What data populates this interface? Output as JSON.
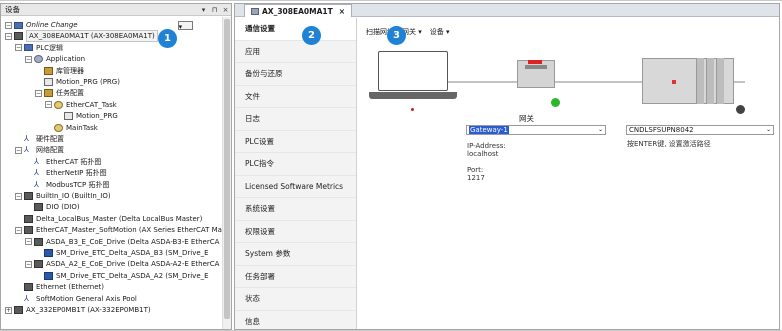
{
  "devices_panel": {
    "title": "设备",
    "header_buttons": [
      "▾",
      "⊓",
      "×"
    ],
    "tree": [
      {
        "label": "Online Change",
        "level": 0,
        "expander": "−",
        "icon": "online-change-icon",
        "italic": true,
        "has_dropdown": true
      },
      {
        "label": "AX_308EA0MA1T (AX-308EA0MA1T)",
        "level": 0,
        "expander": "−",
        "icon": "device-icon",
        "boxed": true
      },
      {
        "label": "PLC逻辑",
        "level": 1,
        "expander": "−",
        "icon": "plc-logic-icon"
      },
      {
        "label": "Application",
        "level": 2,
        "expander": "−",
        "icon": "application-icon"
      },
      {
        "label": "库管理器",
        "level": 3,
        "expander": "",
        "icon": "library-manager-icon"
      },
      {
        "label": "Motion_PRG (PRG)",
        "level": 3,
        "expander": "",
        "icon": "program-icon"
      },
      {
        "label": "任务配置",
        "level": 3,
        "expander": "−",
        "icon": "task-config-icon"
      },
      {
        "label": "EtherCAT_Task",
        "level": 4,
        "expander": "−",
        "icon": "task-icon"
      },
      {
        "label": "Motion_PRG",
        "level": 5,
        "expander": "",
        "icon": "program-icon"
      },
      {
        "label": "MainTask",
        "level": 4,
        "expander": "",
        "icon": "task-icon"
      },
      {
        "label": "硬件配置",
        "level": 1,
        "expander": "",
        "icon": "hardware-config-icon"
      },
      {
        "label": "网络配置",
        "level": 1,
        "expander": "−",
        "icon": "network-config-icon"
      },
      {
        "label": "EtherCAT 拓扑图",
        "level": 2,
        "expander": "",
        "icon": "topology-icon"
      },
      {
        "label": "EtherNetIP 拓扑图",
        "level": 2,
        "expander": "",
        "icon": "topology-icon"
      },
      {
        "label": "ModbusTCP 拓扑图",
        "level": 2,
        "expander": "",
        "icon": "topology-icon"
      },
      {
        "label": "BuiltIn_IO (BuiltIn_IO)",
        "level": 1,
        "expander": "−",
        "icon": "device-icon"
      },
      {
        "label": "DIO (DIO)",
        "level": 2,
        "expander": "",
        "icon": "device-icon"
      },
      {
        "label": "Delta_LocalBus_Master (Delta LocalBus Master)",
        "level": 1,
        "expander": "",
        "icon": "device-icon"
      },
      {
        "label": "EtherCAT_Master_SoftMotion (AX Series EtherCAT Mas",
        "level": 1,
        "expander": "−",
        "icon": "device-icon"
      },
      {
        "label": "ASDA_B3_E_CoE_Drive (Delta ASDA-B3-E EtherCA",
        "level": 2,
        "expander": "−",
        "icon": "device-icon"
      },
      {
        "label": "SM_Drive_ETC_Delta_ASDA_B3 (SM_Drive_E",
        "level": 3,
        "expander": "",
        "icon": "drive-icon"
      },
      {
        "label": "ASDA_A2_E_CoE_Drive (Delta ASDA-A2-E EtherCA",
        "level": 2,
        "expander": "−",
        "icon": "device-icon"
      },
      {
        "label": "SM_Drive_ETC_Delta_ASDA_A2 (SM_Drive_E",
        "level": 3,
        "expander": "",
        "icon": "drive-icon"
      },
      {
        "label": "Ethernet (Ethernet)",
        "level": 1,
        "expander": "",
        "icon": "device-icon"
      },
      {
        "label": "SoftMotion General Axis Pool",
        "level": 1,
        "expander": "",
        "icon": "axis-pool-icon"
      },
      {
        "label": "AX_332EP0MB1T (AX-332EP0MB1T)",
        "level": 0,
        "expander": "+",
        "icon": "device-icon"
      }
    ]
  },
  "editor": {
    "tab_label": "AX_308EA0MA1T",
    "tab_close": "×",
    "nav_items": [
      "通信设置",
      "应用",
      "备份与还原",
      "文件",
      "日志",
      "PLC设置",
      "PLC指令",
      "Licensed Software Metrics",
      "系统设置",
      "权限设置",
      "System 参数",
      "任务部署",
      "状态",
      "信息"
    ],
    "selected_nav": "通信设置",
    "toolbar": [
      "扫描网络",
      "网关 ▾",
      "设备 ▾"
    ],
    "gateway_label": "网关",
    "gateway_select": "Gateway-1",
    "gateway_info": [
      "IP-Address:",
      "localhost",
      "",
      "Port:",
      "1217"
    ],
    "controller_select": "CNDLSFSUPN8042",
    "controller_hint": "按ENTER键, 设置激活路径"
  },
  "badges": [
    "1",
    "2",
    "3"
  ],
  "colors": {
    "badge": "#1f82d4",
    "selection": "#2b5bd0",
    "status_ok": "#2bb82b"
  }
}
